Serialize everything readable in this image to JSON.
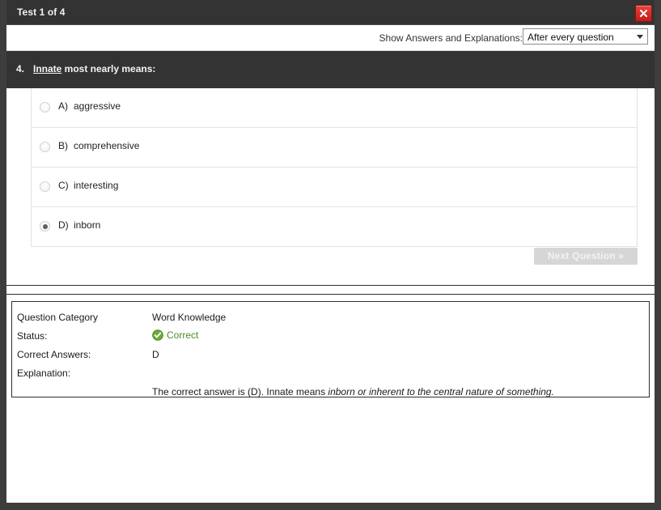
{
  "window": {
    "title": "Test 1 of 4",
    "close_icon": "close-x-icon"
  },
  "toolbar": {
    "show_answers_label": "Show Answers and Explanations:",
    "show_answers_value": "After every question",
    "dropdown_icon": "chevron-down-icon"
  },
  "question": {
    "number": "4.",
    "keyword": "Innate",
    "rest": " most nearly means:",
    "options": [
      {
        "letter": "A)",
        "label": "aggressive",
        "selected": false
      },
      {
        "letter": "B)",
        "label": "comprehensive",
        "selected": false
      },
      {
        "letter": "C)",
        "label": "interesting",
        "selected": false
      },
      {
        "letter": "D)",
        "label": "inborn",
        "selected": true
      }
    ],
    "next_button_label": "Next Question »"
  },
  "explanation": {
    "category_label": "Question Category",
    "category_value": "Word Knowledge",
    "status_label": "Status:",
    "status_value": "Correct",
    "status_icon": "green-check-circle-icon",
    "status_color": "#4f8a2e",
    "correct_answers_label": "Correct Answers:",
    "correct_answers_value": "D",
    "explanation_label": "Explanation:",
    "explanation_plain": "The correct answer is (D).  Innate means ",
    "explanation_italic": "inborn or inherent to the central nature of something."
  }
}
